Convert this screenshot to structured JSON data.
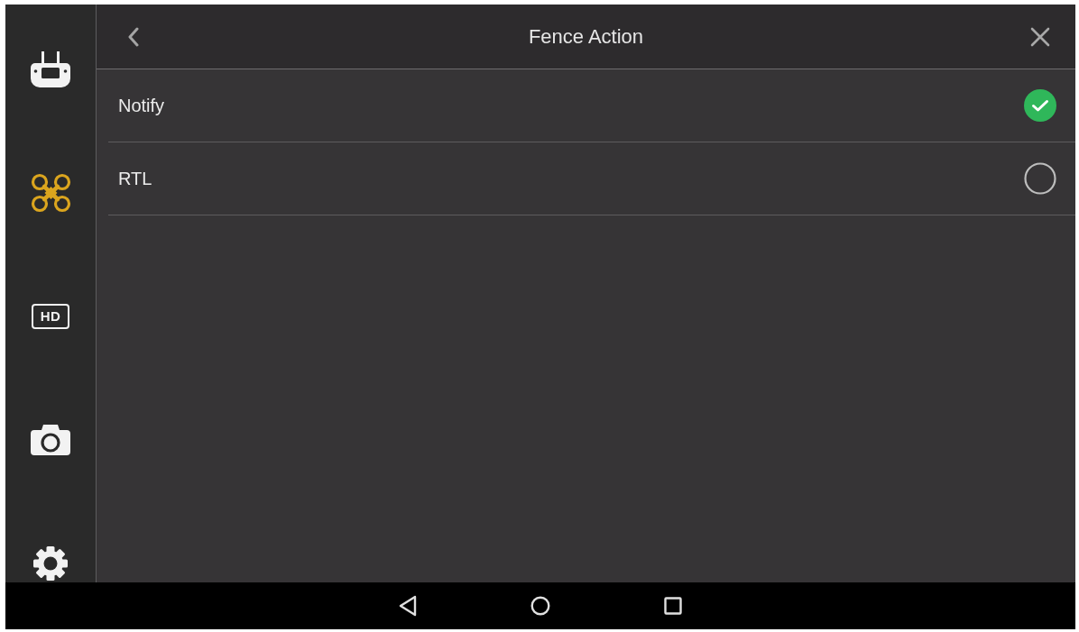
{
  "sidebar": {
    "items": [
      {
        "kind": "remote",
        "selected": false
      },
      {
        "kind": "drone",
        "selected": true
      },
      {
        "kind": "hd",
        "label": "HD",
        "selected": false
      },
      {
        "kind": "camera",
        "selected": false
      },
      {
        "kind": "settings",
        "selected": false
      }
    ]
  },
  "header": {
    "title": "Fence Action"
  },
  "options": [
    {
      "label": "Notify",
      "selected": true
    },
    {
      "label": "RTL",
      "selected": false
    }
  ]
}
